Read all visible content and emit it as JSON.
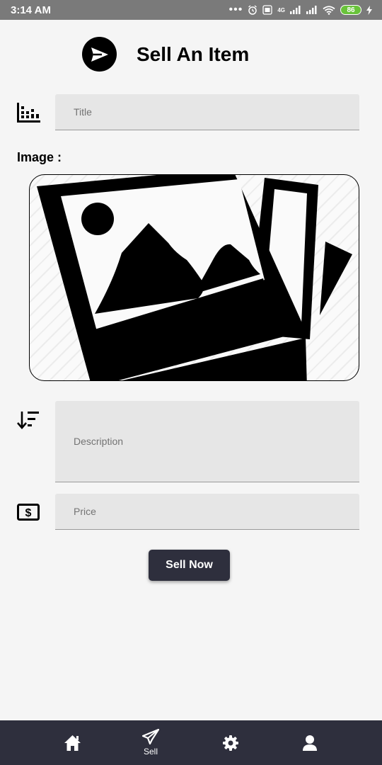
{
  "status_bar": {
    "time": "3:14 AM",
    "network_label": "4G",
    "battery": "86"
  },
  "header": {
    "title": "Sell An Item",
    "icon": "send-icon"
  },
  "form": {
    "title_placeholder": "Title",
    "image_label": "Image :",
    "description_placeholder": "Description",
    "price_placeholder": "Price",
    "submit_label": "Sell Now"
  },
  "nav": {
    "items": [
      {
        "icon": "home-icon",
        "label": ""
      },
      {
        "icon": "send-icon",
        "label": "Sell"
      },
      {
        "icon": "gear-icon",
        "label": ""
      },
      {
        "icon": "profile-icon",
        "label": ""
      }
    ]
  },
  "colors": {
    "status_bar": "#7a7a7a",
    "nav_background": "#2e2f3d",
    "button": "#2e2f3d",
    "field_background": "#e6e6e6",
    "battery": "#69c33a"
  }
}
